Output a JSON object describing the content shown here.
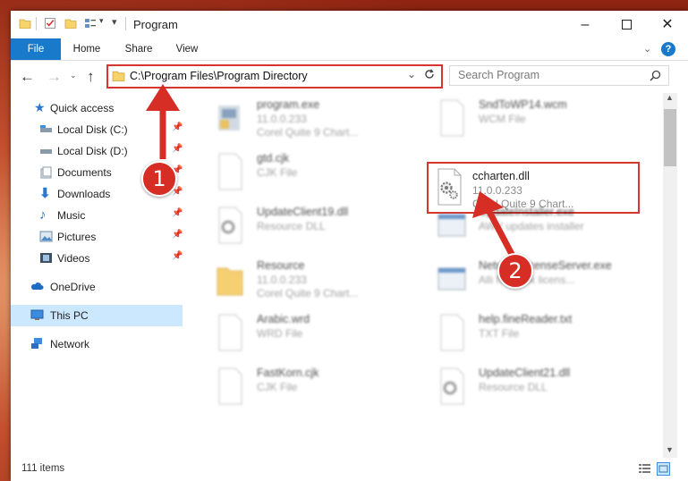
{
  "window": {
    "title": "Program"
  },
  "ribbon": {
    "tabs": [
      "File",
      "Home",
      "Share",
      "View"
    ]
  },
  "address": {
    "path": "C:\\Program Files\\Program Directory"
  },
  "search": {
    "placeholder": "Search Program"
  },
  "sidebar": {
    "items": [
      {
        "label": "Quick access",
        "icon": "star-icon",
        "pinned": false
      },
      {
        "label": "Local Disk (C:)",
        "icon": "drive-icon",
        "pinned": true
      },
      {
        "label": "Local Disk (D:)",
        "icon": "drive-icon",
        "pinned": true
      },
      {
        "label": "Documents",
        "icon": "documents-icon",
        "pinned": true
      },
      {
        "label": "Downloads",
        "icon": "download-icon",
        "pinned": true
      },
      {
        "label": "Music",
        "icon": "music-icon",
        "pinned": true
      },
      {
        "label": "Pictures",
        "icon": "pictures-icon",
        "pinned": true
      },
      {
        "label": "Videos",
        "icon": "videos-icon",
        "pinned": true
      },
      {
        "label": "OneDrive",
        "icon": "cloud-icon",
        "pinned": false
      },
      {
        "label": "This PC",
        "icon": "computer-icon",
        "pinned": false,
        "selected": true
      },
      {
        "label": "Network",
        "icon": "network-icon",
        "pinned": false
      }
    ]
  },
  "files": {
    "left": [
      {
        "name": "program.exe",
        "line1": "11.0.0.233",
        "line2": "Corel Quite 9 Chart...",
        "icon": "exe-icon"
      },
      {
        "name": "gtd.cjk",
        "line1": "CJK File",
        "line2": "",
        "icon": "blank-file-icon"
      },
      {
        "name": "UpdateClient19.dll",
        "line1": "Resource DLL",
        "line2": "",
        "icon": "dll-icon"
      },
      {
        "name": "Resource",
        "line1": "11.0.0.233",
        "line2": "Corel Quite 9 Chart...",
        "icon": "folder-icon"
      },
      {
        "name": "Arabic.wrd",
        "line1": "WRD File",
        "line2": "",
        "icon": "blank-file-icon"
      },
      {
        "name": "FastKorn.cjk",
        "line1": "CJK File",
        "line2": "",
        "icon": "blank-file-icon"
      }
    ],
    "right": [
      {
        "name": "SndToWP14.wcm",
        "line1": "WCM File",
        "line2": "",
        "icon": "blank-file-icon"
      },
      {
        "name": "ccharten.dll",
        "line1": "11.0.0.233",
        "line2": "Corel Quite 9 Chart...",
        "icon": "dll-icon"
      },
      {
        "name": "UpdateInstaller.exe",
        "line1": "AWV updates installer",
        "line2": "",
        "icon": "window-exe-icon"
      },
      {
        "name": "NetworkLicenseServer.exe",
        "line1": "Alli Network licens...",
        "line2": "",
        "icon": "window-exe-icon"
      },
      {
        "name": "help.fineReader.txt",
        "line1": "TXT File",
        "line2": "",
        "icon": "blank-file-icon"
      },
      {
        "name": "UpdateClient21.dll",
        "line1": "Resource DLL",
        "line2": "",
        "icon": "dll-icon"
      }
    ]
  },
  "status": {
    "items": "111 items"
  },
  "annotations": {
    "step1": "1",
    "step2": "2"
  },
  "colors": {
    "accent": "#1979ca",
    "highlight": "#d8342f",
    "selection": "#cce8ff"
  }
}
